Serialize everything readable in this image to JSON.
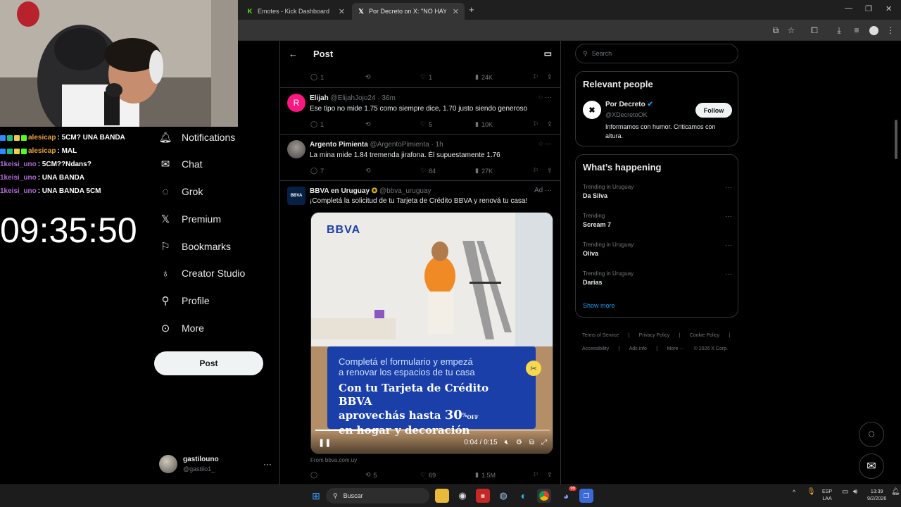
{
  "browser": {
    "tabs": [
      {
        "title": "Emotes - Kick Dashboard",
        "icon": "kick-icon"
      },
      {
        "title": "Por Decreto on X: \"NO HAY TA",
        "icon": "x-icon"
      }
    ]
  },
  "stream": {
    "chat": [
      {
        "user": "alesicap",
        "message": ": 5CM? UNA BANDA",
        "color": "#e8a23c"
      },
      {
        "user": "alesicap",
        "message": ": MAL",
        "color": "#e8a23c"
      },
      {
        "user": "1keisi_uno",
        "message": ": 5CM??Ndans?",
        "color": "#b06ad6"
      },
      {
        "user": "1keisi_uno",
        "message": ": UNA BANDA",
        "color": "#b06ad6"
      },
      {
        "user": "1keisi_uno",
        "message": ": UNA BANDA 5CM",
        "color": "#b06ad6"
      }
    ],
    "clock": "09:35:50"
  },
  "nav": {
    "items": [
      {
        "label": "Notifications",
        "icon": "bell-icon"
      },
      {
        "label": "Chat",
        "icon": "mail-icon"
      },
      {
        "label": "Grok",
        "icon": "grok-icon"
      },
      {
        "label": "Premium",
        "icon": "x-logo-icon"
      },
      {
        "label": "Bookmarks",
        "icon": "bookmark-icon"
      },
      {
        "label": "Creator Studio",
        "icon": "creator-studio-icon"
      },
      {
        "label": "Profile",
        "icon": "person-icon"
      },
      {
        "label": "More",
        "icon": "more-circle-icon"
      }
    ],
    "post_label": "Post",
    "account": {
      "name": "gastilouno",
      "handle": "@gastilo1_"
    }
  },
  "feed": {
    "header_title": "Post",
    "top_actions": {
      "replies": "1",
      "likes": "1",
      "views": "24K"
    },
    "tweets": [
      {
        "avatar_letter": "R",
        "avatar_color": "#f91880",
        "name": "Elijah",
        "handle": "@ElijahJojo24 · 36m",
        "text": "Ese tipo no mide 1.75 como siempre dice, 1.70 justo siendo generoso",
        "replies": "1",
        "reposts": "",
        "likes": "5",
        "views": "10K"
      },
      {
        "avatar_letter": "",
        "avatar_color": "#6b6b6b",
        "name": "Argento Pimienta",
        "handle": "@ArgentoPimienta · 1h",
        "text": "La mina mide 1.84 tremenda jirafona. Él supuestamente 1.76",
        "replies": "7",
        "reposts": "",
        "likes": "84",
        "views": "27K"
      }
    ],
    "ad": {
      "name": "BBVA en Uruguay",
      "handle": "@bbva_uruguay",
      "ad_label": "Ad",
      "text": "¡Completá la solicitud de tu Tarjeta de Crédito BBVA y renová tu casa!",
      "logo": "BBVA",
      "banner_line1": "Completá el formulario y empezá",
      "banner_line2": "a renovar los espacios de tu casa",
      "banner_line3": "Con tu Tarjeta de Crédito BBVA",
      "banner_line4": "aprovechás hasta",
      "banner_percent": "30",
      "banner_pct_sign": "%",
      "banner_off": "OFF",
      "banner_line5": "en hogar y decoración",
      "video_time": "0:04 / 0:15",
      "video_progress": 0.27,
      "source": "From bbva.com.uy",
      "reposts": "5",
      "likes": "69",
      "views": "1.5M"
    }
  },
  "sidebar": {
    "search_placeholder": "Search",
    "relevant_title": "Relevant people",
    "person": {
      "name": "Por Decreto",
      "handle": "@XDecretoOK",
      "bio1": "Informamos con humor. Criticamos con",
      "bio2": "altura.",
      "follow_label": "Follow"
    },
    "happening_title": "What’s happening",
    "trends": [
      {
        "context": "Trending in Uruguay",
        "name": "Da Silva"
      },
      {
        "context": "Trending",
        "name": "Scream 7"
      },
      {
        "context": "Trending in Uruguay",
        "name": "Oliva"
      },
      {
        "context": "Trending in Uruguay",
        "name": "Darias"
      }
    ],
    "show_more": "Show more",
    "footer": [
      "Terms of Service",
      "|",
      "Privacy Policy",
      "|",
      "Cookie Policy",
      "|",
      "Accessibility",
      "|",
      "Ads info",
      "|",
      "More ···",
      "© 2026 X Corp."
    ]
  },
  "taskbar": {
    "search_label": "Buscar",
    "lang1": "ESP",
    "lang2": "LAA",
    "time": "13:39",
    "date": "9/2/2026",
    "discord_badge": "99"
  }
}
